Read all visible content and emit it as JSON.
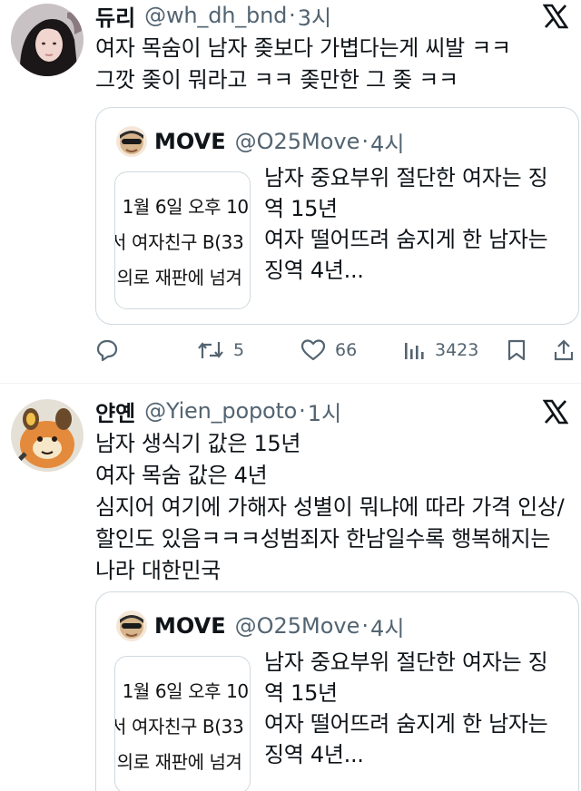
{
  "tweets": [
    {
      "name": "듀리",
      "handle": "@wh_dh_bnd",
      "dot": "·",
      "time": "3시",
      "lines": [
        "여자 목숨이 남자 좆보다 가볍다는게 씨발 ㅋㅋ",
        "그깟 좆이 뭐라고 ㅋㅋ 좆만한 그 좆 ㅋㅋ"
      ],
      "quote": {
        "name": "MOVE",
        "handle": "@O25Move",
        "dot": "·",
        "time": "4시",
        "thumb_lines": [
          "! 1월 6일 오후 10:",
          "서 여자친구 B(33",
          "!의로 재판에 넘겨"
        ],
        "lines": [
          "남자 중요부위 절단한 여자는 징",
          "역 15년",
          "여자 떨어뜨려 숨지게 한 남자는",
          "징역 4년..."
        ]
      },
      "actions": {
        "reply_icon": "reply-icon",
        "retweet_icon": "retweet-icon",
        "retweets": "5",
        "like_icon": "heart-icon",
        "likes": "66",
        "views_icon": "views-icon",
        "views": "3423",
        "bookmark_icon": "bookmark-icon",
        "share_icon": "share-icon"
      }
    },
    {
      "name": "얀옌",
      "handle": "@Yien_popoto",
      "dot": "·",
      "time": "1시",
      "lines": [
        "남자 생식기 값은 15년",
        "여자 목숨 값은 4년",
        "심지어 여기에 가해자 성별이 뭐냐에 따라 가격 인상/",
        "할인도 있음ㅋㅋㅋ성범죄자 한남일수록 행복해지는",
        "나라 대한민국"
      ],
      "quote": {
        "name": "MOVE",
        "handle": "@O25Move",
        "dot": "·",
        "time": "4시",
        "thumb_lines": [
          "! 1월 6일 오후 10:",
          "서 여자친구 B(33",
          "!의로 재판에 넘겨"
        ],
        "lines": [
          "남자 중요부위 절단한 여자는 징",
          "역 15년",
          "여자 떨어뜨려 숨지게 한 남자는",
          "징역 4년..."
        ]
      }
    }
  ],
  "colors": {
    "text": "#0f1419",
    "muted": "#536471",
    "border": "#cfd9de"
  },
  "icons": {
    "x_logo": "x-logo-icon"
  }
}
